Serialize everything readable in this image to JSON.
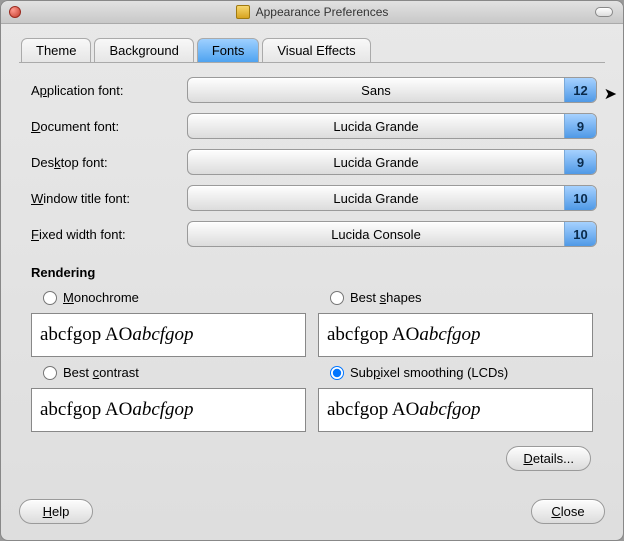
{
  "window": {
    "title": "Appearance Preferences"
  },
  "tabs": {
    "theme": "Theme",
    "background": "Background",
    "fonts": "Fonts",
    "visual_effects": "Visual Effects",
    "active": "fonts"
  },
  "fonts": {
    "application": {
      "label_pre": "A",
      "label_u": "p",
      "label_post": "plication font:",
      "name": "Sans",
      "size": "12"
    },
    "document": {
      "label_pre": "",
      "label_u": "D",
      "label_post": "ocument font:",
      "name": "Lucida Grande",
      "size": "9"
    },
    "desktop": {
      "label_pre": "Des",
      "label_u": "k",
      "label_post": "top font:",
      "name": "Lucida Grande",
      "size": "9"
    },
    "window": {
      "label_pre": "",
      "label_u": "W",
      "label_post": "indow title font:",
      "name": "Lucida Grande",
      "size": "10"
    },
    "fixed": {
      "label_pre": "",
      "label_u": "F",
      "label_post": "ixed width font:",
      "name": "Lucida Console",
      "size": "10"
    }
  },
  "rendering": {
    "heading": "Rendering",
    "monochrome": {
      "pre": "",
      "u": "M",
      "post": "onochrome"
    },
    "shapes": {
      "pre": "Best ",
      "u": "s",
      "post": "hapes"
    },
    "contrast": {
      "pre": "Best ",
      "u": "c",
      "post": "ontrast"
    },
    "subpixel": {
      "pre": "Sub",
      "u": "p",
      "post": "ixel smoothing (LCDs)"
    },
    "selected": "subpixel",
    "sample_plain": "abcfgop AO ",
    "sample_italic": "abcfgop"
  },
  "buttons": {
    "details": {
      "pre": "",
      "u": "D",
      "post": "etails..."
    },
    "help": {
      "pre": "",
      "u": "H",
      "post": "elp"
    },
    "close": {
      "pre": "",
      "u": "C",
      "post": "lose"
    }
  }
}
